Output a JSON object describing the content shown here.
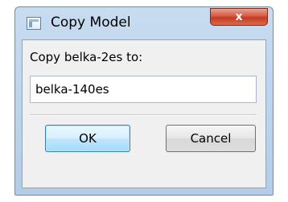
{
  "window": {
    "title": "Copy Model",
    "icon": "application-window-icon",
    "close_glyph": "x",
    "close_color": "#c43b22"
  },
  "form": {
    "prompt": "Copy belka-2es to:",
    "value": "belka-140es"
  },
  "buttons": {
    "ok_label": "OK",
    "cancel_label": "Cancel"
  }
}
